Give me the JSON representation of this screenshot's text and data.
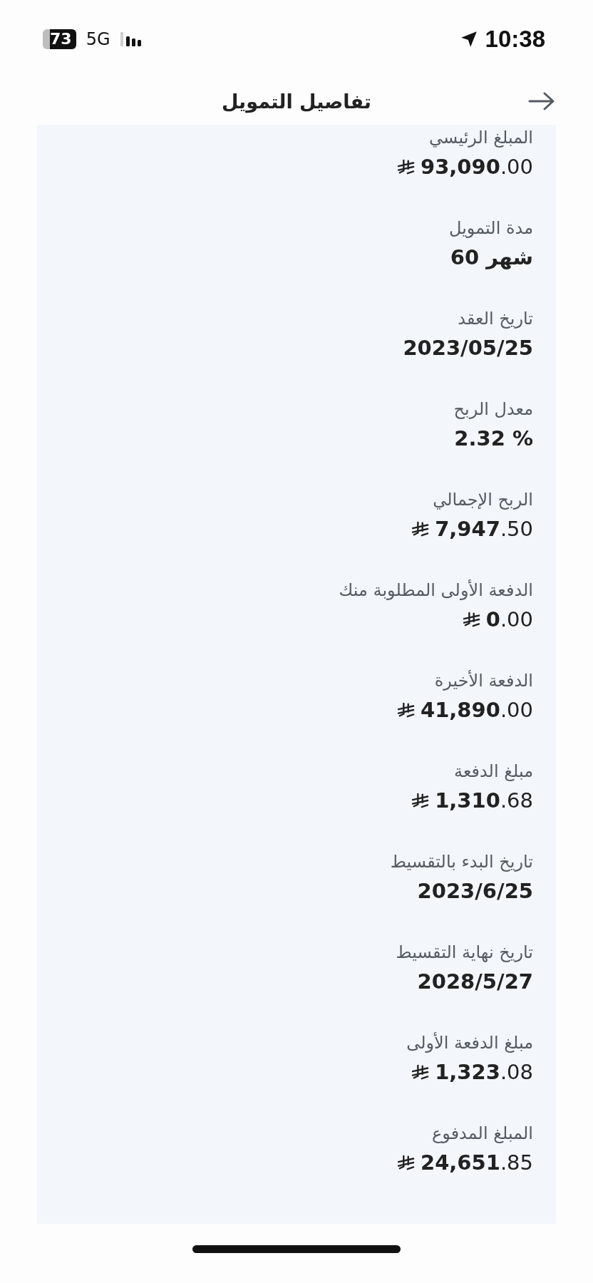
{
  "status_bar": {
    "battery": "73",
    "network": "5G",
    "time": "10:38"
  },
  "header": {
    "title": "تفاصيل التمويل"
  },
  "details": [
    {
      "label": "المبلغ الرئيسي",
      "value": "**93,090**.00",
      "kind": "currency"
    },
    {
      "label": "مدة التمويل",
      "value": "60 شهر",
      "kind": "plain"
    },
    {
      "label": "تاريخ العقد",
      "value": "2023/05/25",
      "kind": "plain"
    },
    {
      "label": "معدل الربح",
      "value": "2.32 %",
      "kind": "plain"
    },
    {
      "label": "الربح الإجمالي",
      "value": "**7,947**.50",
      "kind": "currency"
    },
    {
      "label": "الدفعة الأولى المطلوبة منك",
      "value": "**0**.00",
      "kind": "currency"
    },
    {
      "label": "الدفعة الأخيرة",
      "value": "**41,890**.00",
      "kind": "currency"
    },
    {
      "label": "مبلغ الدفعة",
      "value": "**1,310**.68",
      "kind": "currency"
    },
    {
      "label": "تاريخ البدء بالتقسيط",
      "value": "2023/6/25",
      "kind": "plain"
    },
    {
      "label": "تاريخ نهاية التقسيط",
      "value": "2028/5/27",
      "kind": "plain"
    },
    {
      "label": "مبلغ الدفعة الأولى",
      "value": "**1,323**.08",
      "kind": "currency"
    },
    {
      "label": "المبلغ المدفوع",
      "value": "**24,651**.85",
      "kind": "currency"
    }
  ]
}
